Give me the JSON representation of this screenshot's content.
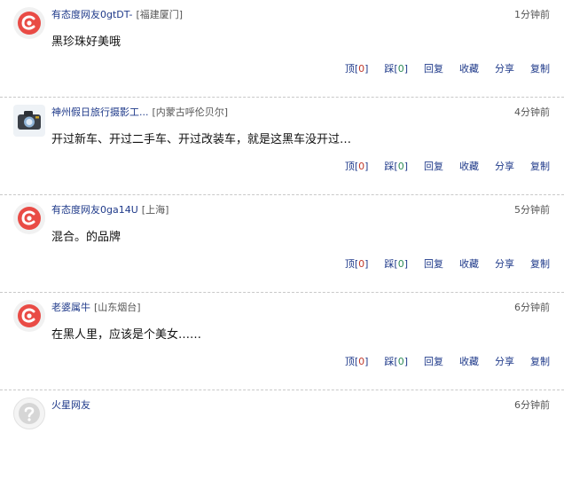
{
  "colors": {
    "username": "#1f3a8a",
    "action": "#1f3a8a",
    "up_count": "#c0392b",
    "down_count": "#2e8b57",
    "divider": "#c9c9c9"
  },
  "action_labels": {
    "up": "顶",
    "down": "踩",
    "reply": "回复",
    "favorite": "收藏",
    "share": "分享",
    "copy": "复制"
  },
  "comments": [
    {
      "avatar": "default-red-avatar-icon",
      "username": "有态度网友0gtDT-",
      "location": "[福建厦门]",
      "time": "1分钟前",
      "content": "黑珍珠好美哦",
      "up_count": "0",
      "down_count": "0"
    },
    {
      "avatar": "camera-avatar-icon",
      "username": "神州假日旅行摄影工...",
      "location": "[内蒙古呼伦贝尔]",
      "time": "4分钟前",
      "content": "开过新车、开过二手车、开过改装车，就是这黑车没开过…",
      "up_count": "0",
      "down_count": "0"
    },
    {
      "avatar": "default-red-avatar-icon",
      "username": "有态度网友0ga14U",
      "location": "[上海]",
      "time": "5分钟前",
      "content": "混合。的品牌",
      "up_count": "0",
      "down_count": "0"
    },
    {
      "avatar": "default-red-avatar-icon",
      "username": "老婆属牛",
      "location": "[山东烟台]",
      "time": "6分钟前",
      "content": "在黑人里，应该是个美女……",
      "up_count": "0",
      "down_count": "0"
    },
    {
      "avatar": "default-gray-avatar-icon",
      "username": "火星网友",
      "location": "",
      "time": "6分钟前",
      "content": "",
      "up_count": "",
      "down_count": ""
    }
  ]
}
